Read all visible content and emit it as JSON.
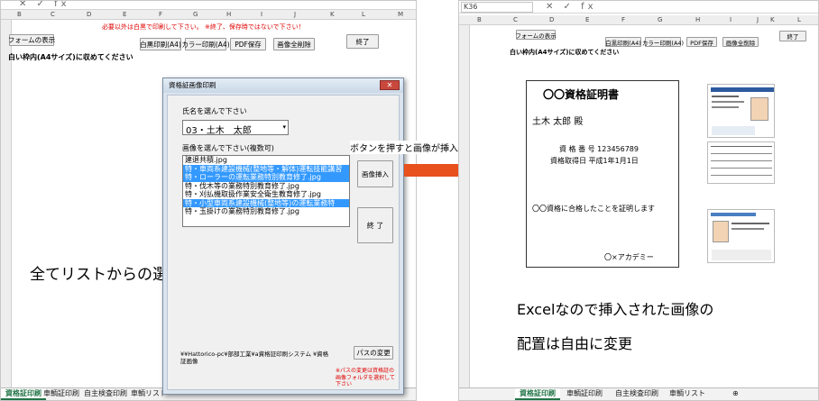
{
  "left_window": {
    "formula_bar_icons": "✕ ✓ fx",
    "columns": [
      "B",
      "C",
      "D",
      "E",
      "F",
      "G",
      "H",
      "I",
      "J",
      "K",
      "L",
      "M"
    ],
    "notice": "必要以外は白黒で印刷して下さい。 ※終了、保存時ではないで下さい！",
    "buttons": {
      "show_form": "フォームの表示",
      "bw_print": "白黒印刷(A4)",
      "color_print": "カラー印刷(A4)",
      "pdf_save": "PDF保存",
      "delete_all": "画像全削除",
      "finish": "終了"
    },
    "heading": "白い枠内(A4サイズ)に収めてください",
    "sheet_tabs": [
      "資格証印刷",
      "車輌証印刷",
      "自主検査印刷",
      "車輌リスト"
    ]
  },
  "dialog": {
    "title": "資格証画像印刷",
    "close": "✕",
    "name_label": "氏名を選んで下さい",
    "name_value": "03・土木　太郎",
    "image_label": "画像を選んで下さい(複数可)",
    "list_items": [
      {
        "text": "建退共積.jpg",
        "selected": false
      },
      {
        "text": "特・車両系建設機械(整地等・解体)運転技能講習",
        "selected": true
      },
      {
        "text": "特・ローラーの運転業務特別教育修了.jpg",
        "selected": true
      },
      {
        "text": "特・伐木等の業務特別教育修了.jpg",
        "selected": false
      },
      {
        "text": "特・刈払機取扱作業安全衛生教育修了.jpg",
        "selected": false
      },
      {
        "text": "特・小型車両系建設機械(整地等)の運転業務特",
        "selected": true
      },
      {
        "text": "特・玉掛けの業務特別教育修了.jpg",
        "selected": false
      }
    ],
    "insert_button": "画像挿入",
    "end_button": "終 了",
    "path_text": "¥¥Hattorico-pc¥部部工業¥a資格証印刷システム ¥資格証画像",
    "change_path_button": "パスの変更",
    "path_note": "※パスの変更は資格証の画像フォルダを選択して下さい"
  },
  "callout_text": "ボタンを押すと画像が挿入されます",
  "left_caption": "全てリストからの選択なので簡単",
  "right_window": {
    "name_box": "K36",
    "formula_bar_icons": "✕ ✓ fx",
    "columns": [
      "B",
      "C",
      "D",
      "E",
      "F",
      "G",
      "H",
      "I",
      "J",
      "K",
      "L"
    ],
    "buttons": {
      "show_form": "フォームの表示",
      "bw_print": "白黒印刷(A4)",
      "color_print": "カラー印刷(A4)",
      "pdf_save": "PDF保存",
      "delete_all": "画像全削除",
      "finish": "終了"
    },
    "heading": "白い枠内(A4サイズ)に収めてください",
    "sheet_tabs": [
      "資格証印刷",
      "車輌証印刷",
      "自主検査印刷",
      "車輌リスト"
    ],
    "add_sheet": "⊕",
    "certificate": {
      "title": "〇〇資格証明書",
      "recipient": "土木 太郎 殿",
      "number_line": "資 格 番 号  123456789",
      "date_line": "資格取得日  平成1年1月1日",
      "body": "〇〇資格に合格したことを証明します",
      "issuer": "〇×アカデミー"
    }
  },
  "right_caption_line1": "Excelなので挿入された画像の",
  "right_caption_line2": "配置は自由に変更",
  "colors": {
    "arrow": "#e8501c",
    "selection": "#3399ff",
    "excel_green": "#217346",
    "notice_red": "#e00000"
  }
}
